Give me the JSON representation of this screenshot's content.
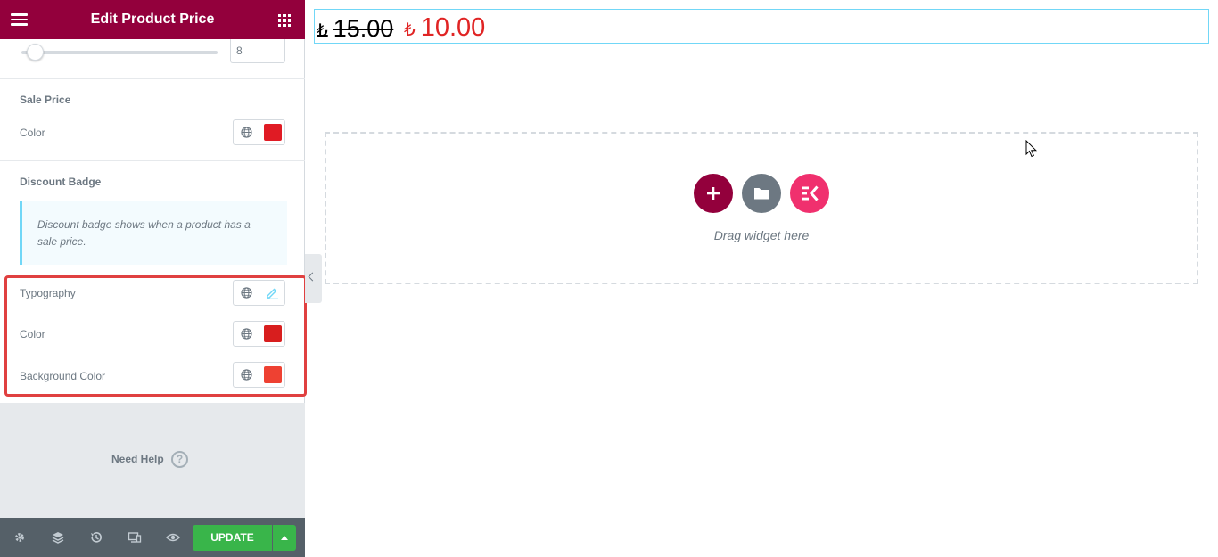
{
  "header": {
    "title": "Edit Product Price"
  },
  "slider": {
    "value": "8"
  },
  "sections": {
    "sale_price": {
      "title": "Sale Price",
      "color_label": "Color",
      "color": "#e01b24"
    },
    "discount_badge": {
      "title": "Discount Badge",
      "notice": "Discount badge shows when a product has a sale price.",
      "typography_label": "Typography",
      "color_label": "Color",
      "color": "#d81e1e",
      "background_label": "Background Color",
      "background_color": "#ee4132"
    }
  },
  "help": {
    "label": "Need Help",
    "icon": "?"
  },
  "footer": {
    "icons": [
      "settings-icon",
      "layers-icon",
      "history-icon",
      "responsive-icon",
      "eye-icon"
    ],
    "update_label": "UPDATE"
  },
  "preview": {
    "currency": "₺",
    "regular_price": "15.00",
    "sale_price": "10.00",
    "drag_text": "Drag widget here"
  },
  "colors": {
    "brand": "#93003c",
    "accent_pink": "#f0306e",
    "update_green": "#39b54a",
    "highlight": "#e04040"
  }
}
